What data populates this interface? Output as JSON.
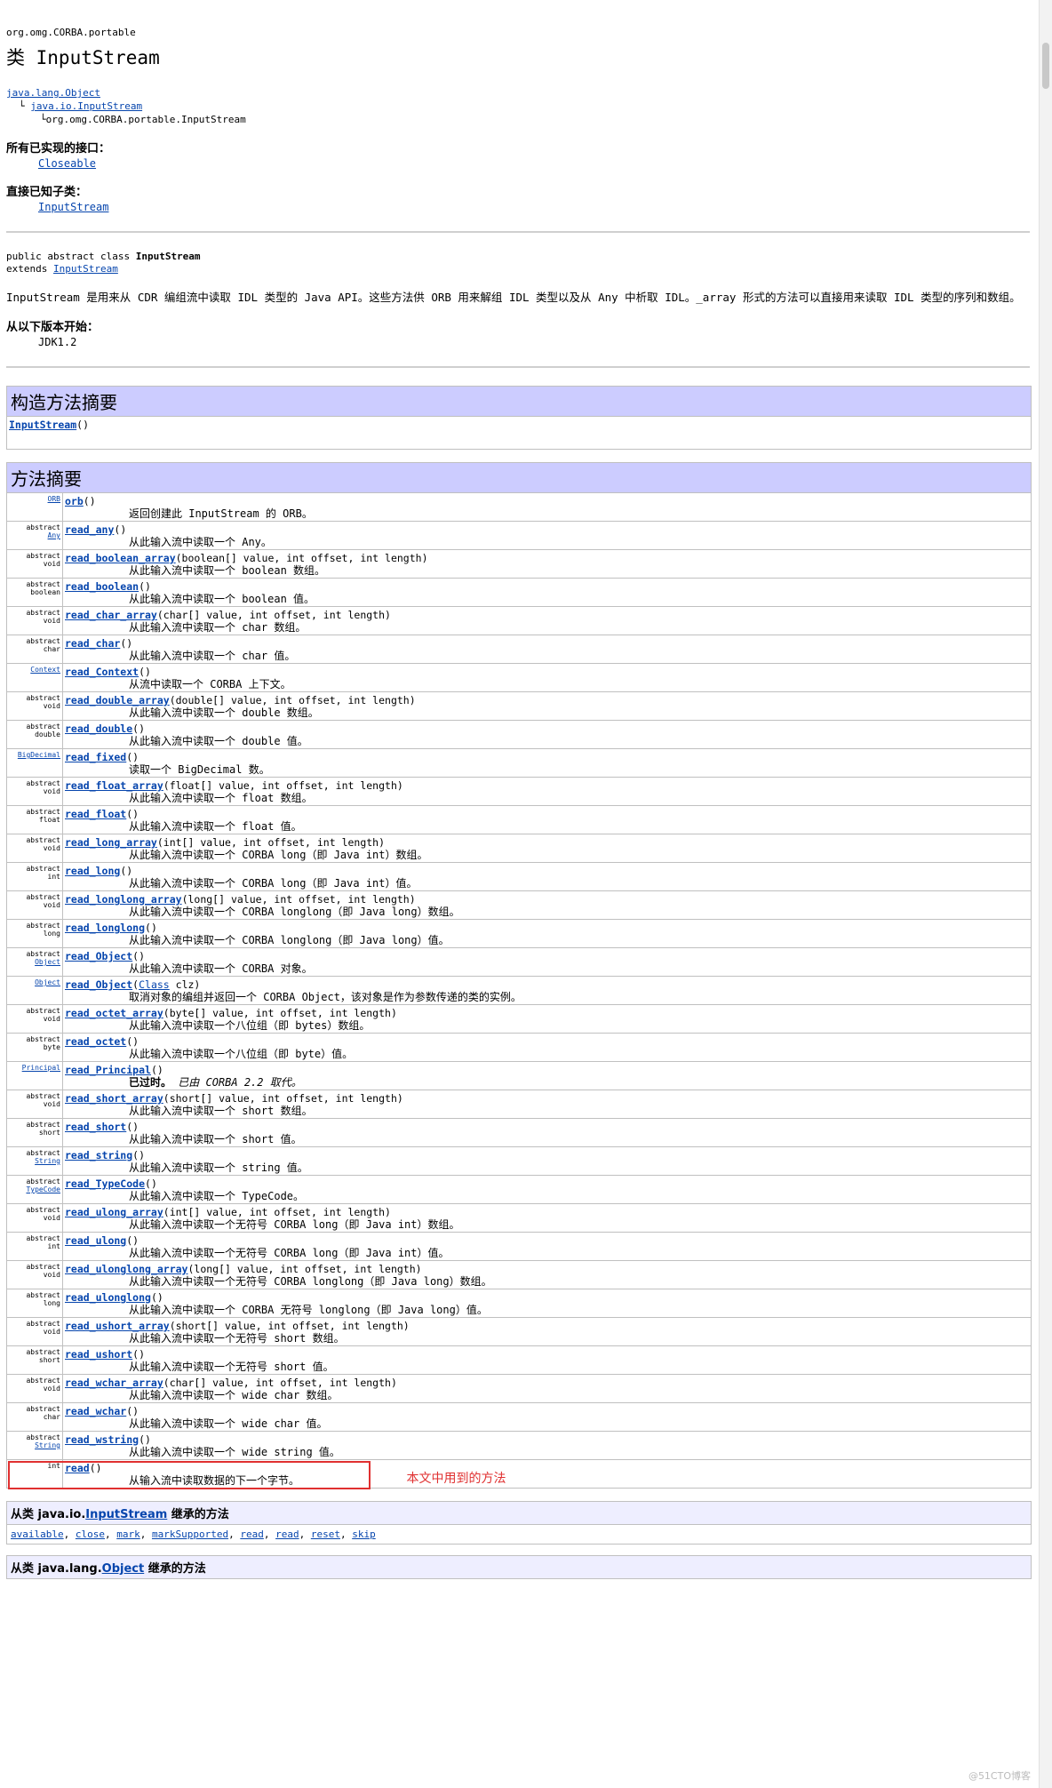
{
  "header": {
    "package": "org.omg.CORBA.portable",
    "class_title": "类 InputStream"
  },
  "tree": {
    "l1": "java.lang.Object",
    "l2_prefix": "└",
    "l2": "java.io.InputStream",
    "l3_prefix": "└",
    "l3": "org.omg.CORBA.portable.InputStream"
  },
  "interfaces": {
    "label": "所有已实现的接口：",
    "value": "Closeable"
  },
  "subclasses": {
    "label": "直接已知子类：",
    "value": "InputStream"
  },
  "declaration": {
    "line1_prefix": "public abstract class ",
    "line1_name": "InputStream",
    "line2_prefix": "extends ",
    "line2_link": "InputStream"
  },
  "description": "InputStream 是用来从 CDR 编组流中读取 IDL 类型的 Java API。这些方法供 ORB 用来解组 IDL 类型以及从 Any 中析取 IDL。_array 形式的方法可以直接用来读取 IDL 类型的序列和数组。",
  "since": {
    "label": "从以下版本开始：",
    "value": "JDK1.2"
  },
  "constructor_summary": {
    "title": "构造方法摘要",
    "name": "InputStream",
    "params": "()"
  },
  "method_summary": {
    "title": "方法摘要",
    "rows": [
      {
        "mod": "",
        "type": "ORB",
        "type_link": true,
        "name": "orb",
        "params": "()",
        "desc": "返回创建此 InputStream 的 ORB。"
      },
      {
        "mod": "abstract",
        "type": "Any",
        "type_link": true,
        "name": "read_any",
        "params": "()",
        "desc": "从此输入流中读取一个 Any。"
      },
      {
        "mod": "abstract",
        "type": "void",
        "type_link": false,
        "name": "read_boolean_array",
        "params": "(boolean[] value, int offset, int length)",
        "desc": "从此输入流中读取一个 boolean 数组。"
      },
      {
        "mod": "abstract",
        "type": "boolean",
        "type_link": false,
        "name": "read_boolean",
        "params": "()",
        "desc": "从此输入流中读取一个 boolean 值。"
      },
      {
        "mod": "abstract",
        "type": "void",
        "type_link": false,
        "name": "read_char_array",
        "params": "(char[] value, int offset, int length)",
        "desc": "从此输入流中读取一个 char 数组。"
      },
      {
        "mod": "abstract",
        "type": "char",
        "type_link": false,
        "name": "read_char",
        "params": "()",
        "desc": "从此输入流中读取一个 char 值。"
      },
      {
        "mod": "",
        "type": "Context",
        "type_link": true,
        "name": "read_Context",
        "params": "()",
        "desc": "从流中读取一个 CORBA 上下文。"
      },
      {
        "mod": "abstract",
        "type": "void",
        "type_link": false,
        "name": "read_double_array",
        "params": "(double[] value, int offset, int length)",
        "desc": "从此输入流中读取一个 double 数组。"
      },
      {
        "mod": "abstract",
        "type": "double",
        "type_link": false,
        "name": "read_double",
        "params": "()",
        "desc": "从此输入流中读取一个 double 值。"
      },
      {
        "mod": "",
        "type": "BigDecimal",
        "type_link": true,
        "name": "read_fixed",
        "params": "()",
        "desc": "读取一个 BigDecimal 数。"
      },
      {
        "mod": "abstract",
        "type": "void",
        "type_link": false,
        "name": "read_float_array",
        "params": "(float[] value, int offset, int length)",
        "desc": "从此输入流中读取一个 float 数组。"
      },
      {
        "mod": "abstract",
        "type": "float",
        "type_link": false,
        "name": "read_float",
        "params": "()",
        "desc": "从此输入流中读取一个 float 值。"
      },
      {
        "mod": "abstract",
        "type": "void",
        "type_link": false,
        "name": "read_long_array",
        "params": "(int[] value, int offset, int length)",
        "desc": "从此输入流中读取一个 CORBA long（即 Java int）数组。"
      },
      {
        "mod": "abstract",
        "type": "int",
        "type_link": false,
        "name": "read_long",
        "params": "()",
        "desc": "从此输入流中读取一个 CORBA long（即 Java int）值。"
      },
      {
        "mod": "abstract",
        "type": "void",
        "type_link": false,
        "name": "read_longlong_array",
        "params": "(long[] value, int offset, int length)",
        "desc": "从此输入流中读取一个 CORBA longlong（即 Java long）数组。"
      },
      {
        "mod": "abstract",
        "type": "long",
        "type_link": false,
        "name": "read_longlong",
        "params": "()",
        "desc": "从此输入流中读取一个 CORBA longlong（即 Java long）值。"
      },
      {
        "mod": "abstract",
        "type": "Object",
        "type_link": true,
        "name": "read_Object",
        "params": "()",
        "desc": "从此输入流中读取一个 CORBA 对象。"
      },
      {
        "mod": "",
        "type": "Object",
        "type_link": true,
        "name": "read_Object",
        "params_link": "Class",
        "params": " clz)",
        "params_open": "(",
        "desc": "取消对象的编组并返回一个 CORBA Object，该对象是作为参数传递的类的实例。"
      },
      {
        "mod": "abstract",
        "type": "void",
        "type_link": false,
        "name": "read_octet_array",
        "params": "(byte[] value, int offset, int length)",
        "desc": "从此输入流中读取一个八位组（即 bytes）数组。"
      },
      {
        "mod": "abstract",
        "type": "byte",
        "type_link": false,
        "name": "read_octet",
        "params": "()",
        "desc": "从此输入流中读取一个八位组（即 byte）值。"
      },
      {
        "mod": "",
        "type": "Principal",
        "type_link": true,
        "name": "read_Principal",
        "params": "()",
        "desc": "已过时。",
        "desc_extra": "已由 CORBA 2.2 取代。"
      },
      {
        "mod": "abstract",
        "type": "void",
        "type_link": false,
        "name": "read_short_array",
        "params": "(short[] value, int offset, int length)",
        "desc": "从此输入流中读取一个 short 数组。"
      },
      {
        "mod": "abstract",
        "type": "short",
        "type_link": false,
        "name": "read_short",
        "params": "()",
        "desc": "从此输入流中读取一个 short 值。"
      },
      {
        "mod": "abstract",
        "type": "String",
        "type_link": true,
        "name": "read_string",
        "params": "()",
        "desc": "从此输入流中读取一个 string 值。"
      },
      {
        "mod": "abstract",
        "type": "TypeCode",
        "type_link": true,
        "name": "read_TypeCode",
        "params": "()",
        "desc": "从此输入流中读取一个 TypeCode。"
      },
      {
        "mod": "abstract",
        "type": "void",
        "type_link": false,
        "name": "read_ulong_array",
        "params": "(int[] value, int offset, int length)",
        "desc": "从此输入流中读取一个无符号 CORBA long（即 Java int）数组。"
      },
      {
        "mod": "abstract",
        "type": "int",
        "type_link": false,
        "name": "read_ulong",
        "params": "()",
        "desc": "从此输入流中读取一个无符号 CORBA long（即 Java int）值。"
      },
      {
        "mod": "abstract",
        "type": "void",
        "type_link": false,
        "name": "read_ulonglong_array",
        "params": "(long[] value, int offset, int length)",
        "desc": "从此输入流中读取一个无符号 CORBA longlong（即 Java long）数组。"
      },
      {
        "mod": "abstract",
        "type": "long",
        "type_link": false,
        "name": "read_ulonglong",
        "params": "()",
        "desc": "从此输入流中读取一个 CORBA 无符号 longlong（即 Java long）值。"
      },
      {
        "mod": "abstract",
        "type": "void",
        "type_link": false,
        "name": "read_ushort_array",
        "params": "(short[] value, int offset, int length)",
        "desc": "从此输入流中读取一个无符号 short 数组。"
      },
      {
        "mod": "abstract",
        "type": "short",
        "type_link": false,
        "name": "read_ushort",
        "params": "()",
        "desc": "从此输入流中读取一个无符号 short 值。"
      },
      {
        "mod": "abstract",
        "type": "void",
        "type_link": false,
        "name": "read_wchar_array",
        "params": "(char[] value, int offset, int length)",
        "desc": "从此输入流中读取一个 wide char 数组。"
      },
      {
        "mod": "abstract",
        "type": "char",
        "type_link": false,
        "name": "read_wchar",
        "params": "()",
        "desc": "从此输入流中读取一个 wide char 值。"
      },
      {
        "mod": "abstract",
        "type": "String",
        "type_link": true,
        "name": "read_wstring",
        "params": "()",
        "desc": "从此输入流中读取一个 wide string 值。"
      },
      {
        "mod": "",
        "type": "int",
        "type_link": false,
        "name": "read",
        "params": "()",
        "desc": "从输入流中读取数据的下一个字节。"
      }
    ]
  },
  "annotation": {
    "note": "本文中用到的方法",
    "color": "#e03030"
  },
  "inherited_io": {
    "prefix": "从类 java.io.",
    "link": "InputStream",
    "suffix": " 继承的方法",
    "methods": [
      "available",
      "close",
      "mark",
      "markSupported",
      "read",
      "read",
      "reset",
      "skip"
    ]
  },
  "inherited_lang": {
    "prefix": "从类 java.lang.",
    "link": "Object",
    "suffix": " 继承的方法"
  },
  "watermark": "@51CTO博客",
  "colors": {
    "section_header": "#ccccff",
    "inherited_header": "#eeeeff",
    "link": "#0645ad",
    "highlight": "#e03030"
  }
}
